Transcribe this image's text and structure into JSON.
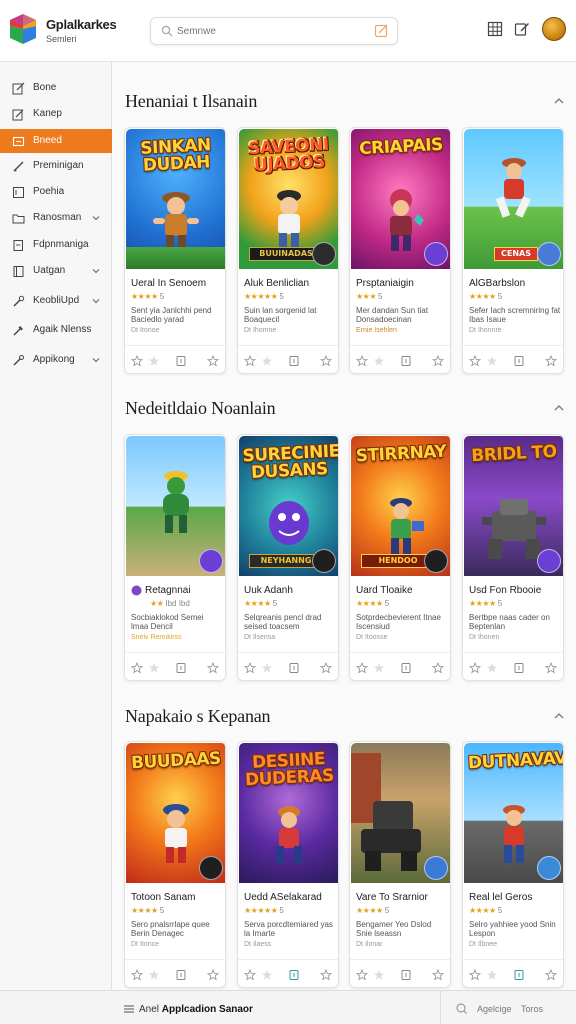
{
  "app": {
    "title": "Gplalkarkes",
    "subtitle": "Semleri",
    "search_placeholder": "Semnwe"
  },
  "header_icons": [
    "grid-icon",
    "edit-icon",
    "avatar"
  ],
  "sidebar": {
    "items": [
      {
        "label": "Bone",
        "icon": "edit-icon",
        "chevron": false
      },
      {
        "label": "Kanep",
        "icon": "pen-icon",
        "chevron": false
      },
      {
        "label": "Bneed",
        "icon": "box-icon",
        "chevron": false,
        "active": true
      },
      {
        "label": "Preminigan",
        "icon": "pen-icon",
        "chevron": false
      },
      {
        "label": "Poehia",
        "icon": "note-icon",
        "chevron": false
      },
      {
        "label": "Ranosman",
        "icon": "folder-icon",
        "chevron": true
      },
      {
        "label": "Fdpnmaniga",
        "icon": "doc-icon",
        "chevron": false
      },
      {
        "label": "Uatgan",
        "icon": "book-icon",
        "chevron": true
      },
      {
        "label": "KeobliUpd",
        "icon": "wrench-icon",
        "chevron": true
      },
      {
        "label": "Agaik Nlenss",
        "icon": "tool-icon",
        "chevron": false
      },
      {
        "label": "Appikong",
        "icon": "link-icon",
        "chevron": true
      }
    ]
  },
  "sections": [
    {
      "title": "Henaniai t Ilsanain",
      "cards": [
        {
          "cover_title": "SINKAN DUDAH",
          "cover_banner": "",
          "title": "Ueral In Senoem",
          "stars": "★★★★",
          "count": "5",
          "desc": "Sent yia Janlchhi pend Baciedlo yarad",
          "meta": "Dt Itonoe",
          "cover": "c1"
        },
        {
          "cover_title": "SAVEONI UJADOS",
          "cover_banner": "BUUINADAS",
          "title": "Aluk Benliclian",
          "stars": "★★★★★",
          "count": "5",
          "desc": "Suin lan sorgenid lat Boaquecil",
          "meta": "Dt Ihomne",
          "cover": "c2"
        },
        {
          "cover_title": "CRIAPAIS",
          "cover_banner": "",
          "title": "Prsptaniaigin",
          "stars": "★★★",
          "count": "5",
          "desc": "Mer dandan Sun tiat Donsadoecinan",
          "meta": "Ernie Isehlen",
          "cover": "c3"
        },
        {
          "cover_title": "",
          "cover_banner": "CENAS",
          "title": "AlGBarbslon",
          "stars": "★★★★",
          "count": "5",
          "desc": "Sefer Iach scremniring fat Ibas Isaue",
          "meta": "Dt Ihonnre",
          "cover": "c4"
        }
      ]
    },
    {
      "title": "Nedeitldaio Noanlain",
      "cards": [
        {
          "cover_title": "",
          "cover_banner": "",
          "title": "Retagnnai",
          "stars": "★★",
          "count": "Ibd Ibd",
          "desc": "Socbiaklokod Semei lmaa Dencil",
          "meta": "Sneiv Rennkirss",
          "cover": "c5"
        },
        {
          "cover_title": "SURECINIE DUSANS",
          "cover_banner": "NEYHANNG",
          "title": "Uuk Adanh",
          "stars": "★★★★",
          "count": "5",
          "desc": "Selqreanis pencl drad seised toacsem",
          "meta": "Dt Ilsensa",
          "cover": "c6"
        },
        {
          "cover_title": "STIRRNAY",
          "cover_banner": "HENDOO",
          "title": "Uard Tloaike",
          "stars": "★★★★",
          "count": "5",
          "desc": "Sotprdecbevierent Itnae Iscensiud",
          "meta": "Dt Itoosse",
          "cover": "c7"
        },
        {
          "cover_title": "BRIDL TO",
          "cover_banner": "",
          "title": "Usd Fon Rbooie",
          "stars": "★★★★",
          "count": "5",
          "desc": "Bertbpe naas cader on Beptenlan",
          "meta": "Dt Ihonen",
          "cover": "c8"
        }
      ]
    },
    {
      "title": "Napakaio s Kepanan",
      "cards": [
        {
          "cover_title": "BUUDAAS",
          "cover_banner": "",
          "title": "Totoon Sanam",
          "stars": "★★★★",
          "count": "5",
          "desc": "Sero pnalsrrlape quee Berin Denagec",
          "meta": "Dt Itonce",
          "cover": "c9"
        },
        {
          "cover_title": "DESIINE DUDERAS",
          "cover_banner": "",
          "title": "Uedd ASelakarad",
          "stars": "★★★★★",
          "count": "5",
          "desc": "Serva porcdtemiared yas la Imarte",
          "meta": "Dt Ilaess",
          "cover": "c10"
        },
        {
          "cover_title": "",
          "cover_banner": "",
          "title": "Vare To Srarnior",
          "stars": "★★★★",
          "count": "5",
          "desc": "Bengamer Yeo Dslod Snie lseassn",
          "meta": "Dt Ilonar",
          "cover": "c11"
        },
        {
          "cover_title": "DUTNAVAV",
          "cover_banner": "",
          "title": "Real lel Geros",
          "stars": "★★★★",
          "count": "5",
          "desc": "Selro yahhiee yood Snin Lespon",
          "meta": "Dt Ilbnee",
          "cover": "c12"
        }
      ]
    }
  ],
  "footer": {
    "left_prefix": "Anel",
    "left_bold": "Applcadion Sanaor",
    "right_label": "Agelcige",
    "right_label2": "Toros"
  },
  "colors": {
    "accent": "#ee7a1e",
    "star": "#e3a21a",
    "sidebar_bg": "#f7f7f7"
  }
}
